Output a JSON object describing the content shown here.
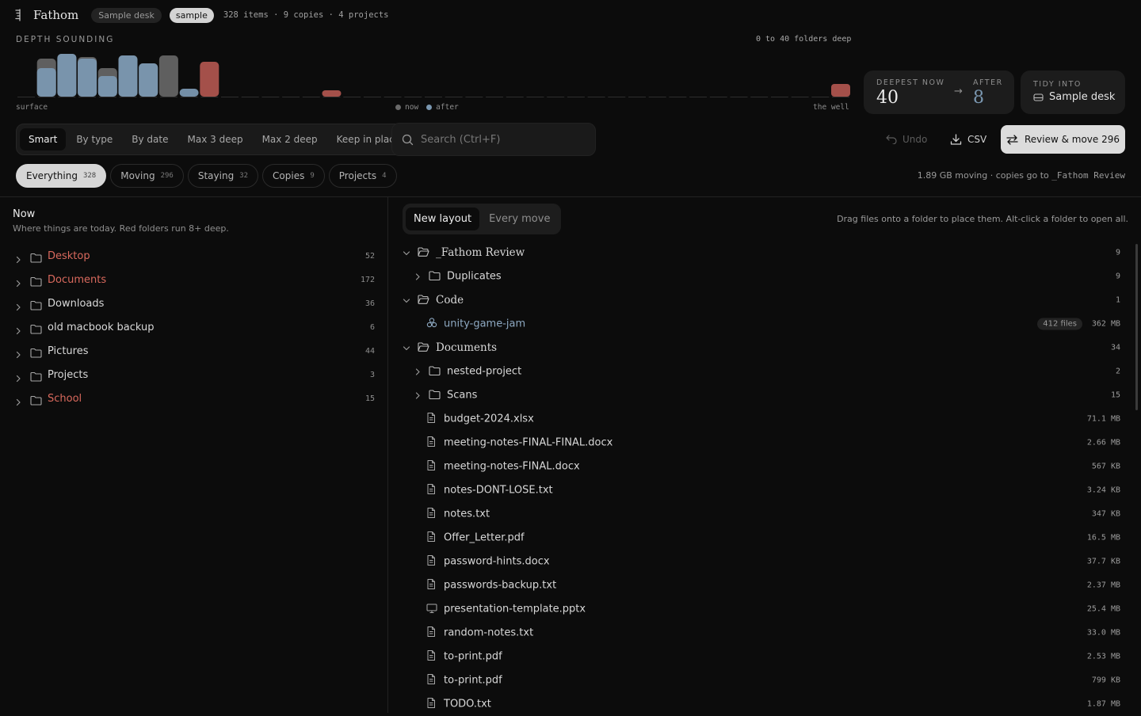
{
  "header": {
    "app_name": "Fathom",
    "desk_chip": "Sample desk",
    "mode_chip": "sample",
    "stats": "328 items · 9 copies · 4 projects"
  },
  "depth": {
    "title": "DEPTH SOUNDING",
    "range": "0 to 40 folders deep",
    "surface_label": "surface",
    "well_label": "the well",
    "legend_now": "now",
    "legend_after": "after",
    "chart_data": {
      "type": "bar",
      "description_levels": "depth levels 0..40; each level shows items now (grey/red) and after (blue)",
      "now": [
        0,
        48,
        54,
        50,
        36,
        52,
        42,
        52,
        0,
        44,
        0,
        0,
        0,
        0,
        0,
        8,
        0,
        0,
        0,
        0,
        0,
        0,
        0,
        0,
        0,
        0,
        0,
        0,
        0,
        0,
        0,
        0,
        0,
        0,
        0,
        0,
        0,
        0,
        0,
        0,
        16
      ],
      "after": [
        0,
        36,
        54,
        48,
        26,
        52,
        42,
        0,
        10,
        0,
        0,
        0,
        0,
        0,
        0,
        0,
        0,
        0,
        0,
        0,
        0,
        0,
        0,
        0,
        0,
        0,
        0,
        0,
        0,
        0,
        0,
        0,
        0,
        0,
        0,
        0,
        0,
        0,
        0,
        0,
        0
      ],
      "red_from_level": 8,
      "colors": {
        "now": "#5f5f5f",
        "after": "#7a97b0",
        "deep": "#a4504a",
        "after_faded": "#9bb0c2"
      }
    },
    "deepest_label": "DEEPEST NOW",
    "deepest_value": "40",
    "after_label": "AFTER",
    "after_value": "8",
    "tidy_label": "TIDY INTO",
    "tidy_value": "Sample desk"
  },
  "toolbar": {
    "modes": [
      "Smart",
      "By type",
      "By date",
      "Max 3 deep",
      "Max 2 deep",
      "Keep in place"
    ],
    "active_mode": "Smart",
    "search_placeholder": "Search (Ctrl+F)",
    "undo_label": "Undo",
    "csv_label": "CSV",
    "review_label": "Review & move 296"
  },
  "filters": {
    "items": [
      {
        "label": "Everything",
        "count": "328"
      },
      {
        "label": "Moving",
        "count": "296"
      },
      {
        "label": "Staying",
        "count": "32"
      },
      {
        "label": "Copies",
        "count": "9"
      },
      {
        "label": "Projects",
        "count": "4"
      }
    ],
    "info_prefix": "1.89 GB moving · copies go to",
    "info_target": "_Fathom Review"
  },
  "left": {
    "title": "Now",
    "subtitle": "Where things are today. Red folders run 8+ deep.",
    "folders": [
      {
        "name": "Desktop",
        "count": "52",
        "deep": true
      },
      {
        "name": "Documents",
        "count": "172",
        "deep": true
      },
      {
        "name": "Downloads",
        "count": "36",
        "deep": false
      },
      {
        "name": "old macbook backup",
        "count": "6",
        "deep": false
      },
      {
        "name": "Pictures",
        "count": "44",
        "deep": false
      },
      {
        "name": "Projects",
        "count": "3",
        "deep": false
      },
      {
        "name": "School",
        "count": "15",
        "deep": true
      }
    ]
  },
  "right": {
    "tabs": [
      "New layout",
      "Every move"
    ],
    "active_tab": "New layout",
    "hint": "Drag files onto a folder to place them. Alt-click a folder to open all.",
    "rows": [
      {
        "kind": "open-folder",
        "level": 0,
        "name": "_Fathom Review",
        "value": "9"
      },
      {
        "kind": "folder",
        "level": 1,
        "name": "Duplicates",
        "value": "9"
      },
      {
        "kind": "open-folder",
        "level": 0,
        "name": "Code",
        "value": "1"
      },
      {
        "kind": "project",
        "level": 1,
        "name": "unity-game-jam",
        "badge": "412 files",
        "value": "362 MB"
      },
      {
        "kind": "open-folder",
        "level": 0,
        "name": "Documents",
        "value": "34"
      },
      {
        "kind": "folder",
        "level": 1,
        "name": "nested-project",
        "value": "2"
      },
      {
        "kind": "folder",
        "level": 1,
        "name": "Scans",
        "value": "15"
      },
      {
        "kind": "file",
        "level": 1,
        "name": "budget-2024.xlsx",
        "value": "71.1 MB"
      },
      {
        "kind": "file",
        "level": 1,
        "name": "meeting-notes-FINAL-FINAL.docx",
        "value": "2.66 MB"
      },
      {
        "kind": "file",
        "level": 1,
        "name": "meeting-notes-FINAL.docx",
        "value": "567 KB"
      },
      {
        "kind": "file",
        "level": 1,
        "name": "notes-DONT-LOSE.txt",
        "value": "3.24 KB"
      },
      {
        "kind": "file",
        "level": 1,
        "name": "notes.txt",
        "value": "347 KB"
      },
      {
        "kind": "file",
        "level": 1,
        "name": "Offer_Letter.pdf",
        "value": "16.5 MB"
      },
      {
        "kind": "file",
        "level": 1,
        "name": "password-hints.docx",
        "value": "37.7 KB"
      },
      {
        "kind": "file",
        "level": 1,
        "name": "passwords-backup.txt",
        "value": "2.37 MB"
      },
      {
        "kind": "slides",
        "level": 1,
        "name": "presentation-template.pptx",
        "value": "25.4 MB"
      },
      {
        "kind": "file",
        "level": 1,
        "name": "random-notes.txt",
        "value": "33.0 MB"
      },
      {
        "kind": "file",
        "level": 1,
        "name": "to-print.pdf",
        "value": "2.53 MB"
      },
      {
        "kind": "file",
        "level": 1,
        "name": "to-print.pdf",
        "value": "799 KB"
      },
      {
        "kind": "file",
        "level": 1,
        "name": "TODO.txt",
        "value": "1.87 MB"
      }
    ]
  }
}
